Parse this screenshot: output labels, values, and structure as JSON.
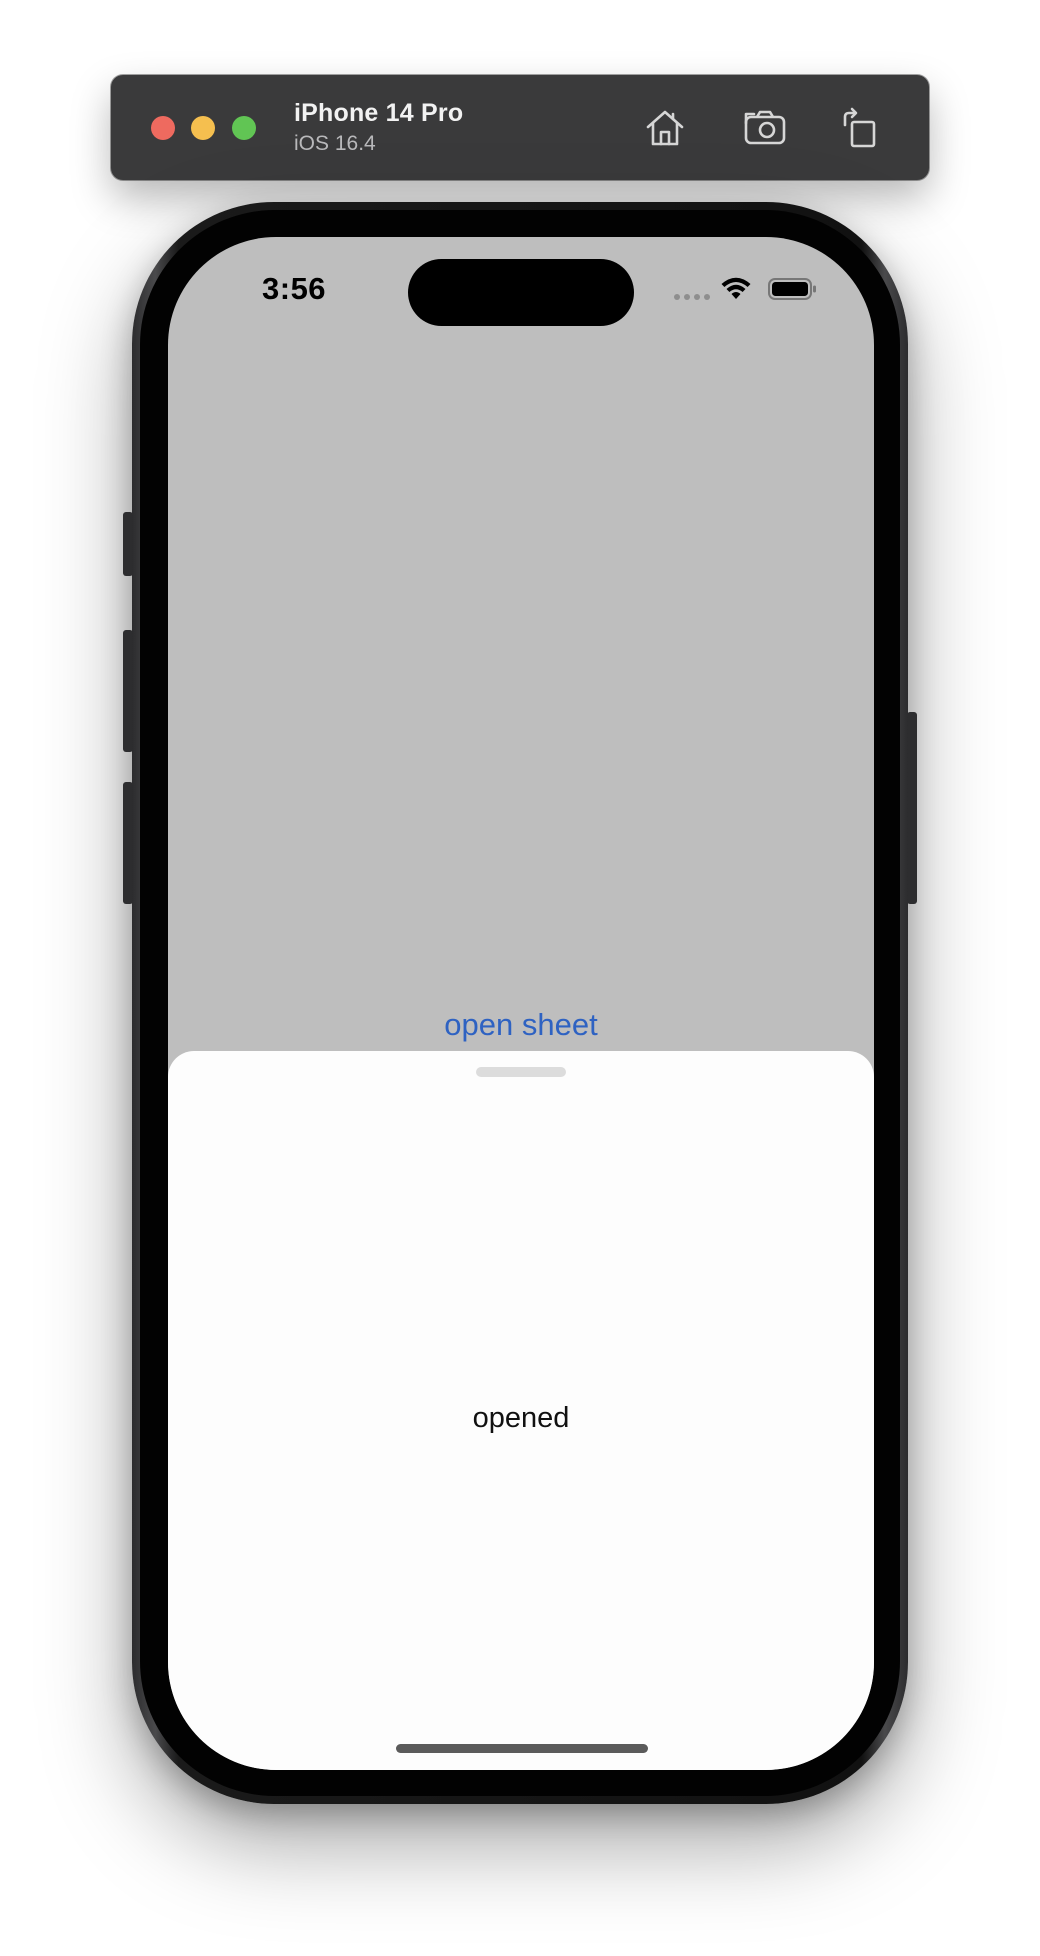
{
  "toolbar": {
    "device_name": "iPhone 14 Pro",
    "os_version": "iOS 16.4",
    "buttons": [
      {
        "icon": "home-icon"
      },
      {
        "icon": "screenshot-icon"
      },
      {
        "icon": "rotate-icon"
      }
    ]
  },
  "window_controls": [
    "close",
    "minimize",
    "zoom"
  ],
  "status_bar": {
    "time": "3:56",
    "icons": [
      "signal-icon",
      "wifi-icon",
      "battery-icon"
    ]
  },
  "main": {
    "open_sheet_label": "open sheet"
  },
  "sheet": {
    "text": "opened"
  },
  "colors": {
    "toolbar_bg": "#3a3a3b",
    "screen_bg": "#bebebe",
    "sheet_bg": "#fdfdfd",
    "link": "#2e62c2",
    "close": "#ee6a5f",
    "minimize": "#f5bf4f",
    "zoom": "#61c554"
  }
}
